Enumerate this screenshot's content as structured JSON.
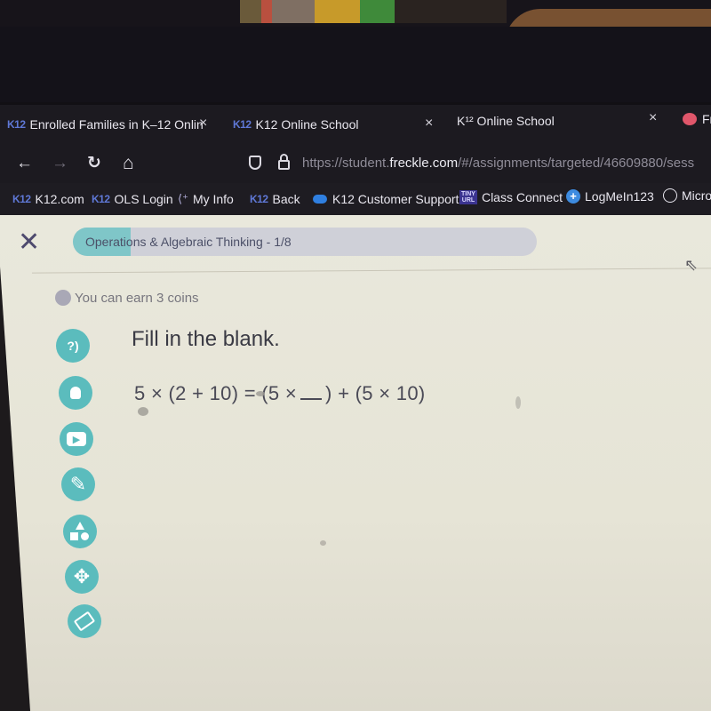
{
  "browser": {
    "tabs": [
      {
        "icon": "K12",
        "label": "Enrolled Families in K–12 Onlin",
        "close": "×"
      },
      {
        "icon": "K12",
        "label": "K12 Online School",
        "close": "×"
      },
      {
        "icon": "",
        "label": "K¹² Online School",
        "close": "×"
      },
      {
        "icon": "pig",
        "label": "Fr"
      }
    ],
    "nav": {
      "back": "←",
      "forward": "→",
      "reload": "↻",
      "home": "⌂",
      "url_prefix": "https://student.",
      "url_domain": "freckle.com",
      "url_path": "/#/assignments/targeted/46609880/sess"
    },
    "bookmarks": [
      {
        "icon": "K12",
        "label": "K12.com"
      },
      {
        "icon": "K12",
        "label": "OLS Login"
      },
      {
        "icon": "myinfo",
        "label": "My Info"
      },
      {
        "icon": "K12",
        "label": "Back"
      },
      {
        "icon": "cloud",
        "label": "K12 Customer Support"
      },
      {
        "icon": "tinyurl",
        "icon_text_top": "TINY",
        "icon_text_bottom": "URL",
        "label": "Class Connect"
      },
      {
        "icon": "plus",
        "label": "LogMeIn123"
      },
      {
        "icon": "globe",
        "label": "Micro"
      }
    ]
  },
  "assignment": {
    "close_icon": "✕",
    "progress_label": "Operations & Algebraic Thinking - 1/8",
    "progress_fraction": 0.125,
    "coins_text": "You can earn 3 coins",
    "prompt": "Fill in the blank.",
    "equation_left": "5 × (2 + 10) = (5 ×",
    "equation_right": ") + (5 × 10)",
    "tools": [
      {
        "name": "read-aloud",
        "glyph": "?)"
      },
      {
        "name": "hint",
        "glyph": "💡"
      },
      {
        "name": "video",
        "glyph": "▶"
      },
      {
        "name": "pencil",
        "glyph": "✎"
      },
      {
        "name": "shapes",
        "glyph": "△"
      },
      {
        "name": "move",
        "glyph": "✥"
      },
      {
        "name": "eraser",
        "glyph": "⌫"
      }
    ]
  },
  "colors": {
    "accent_teal": "#5bbcbd",
    "progress_fill": "#7fc6c8",
    "progress_track": "#cfd0d8",
    "close_x": "#4e4a6e"
  }
}
